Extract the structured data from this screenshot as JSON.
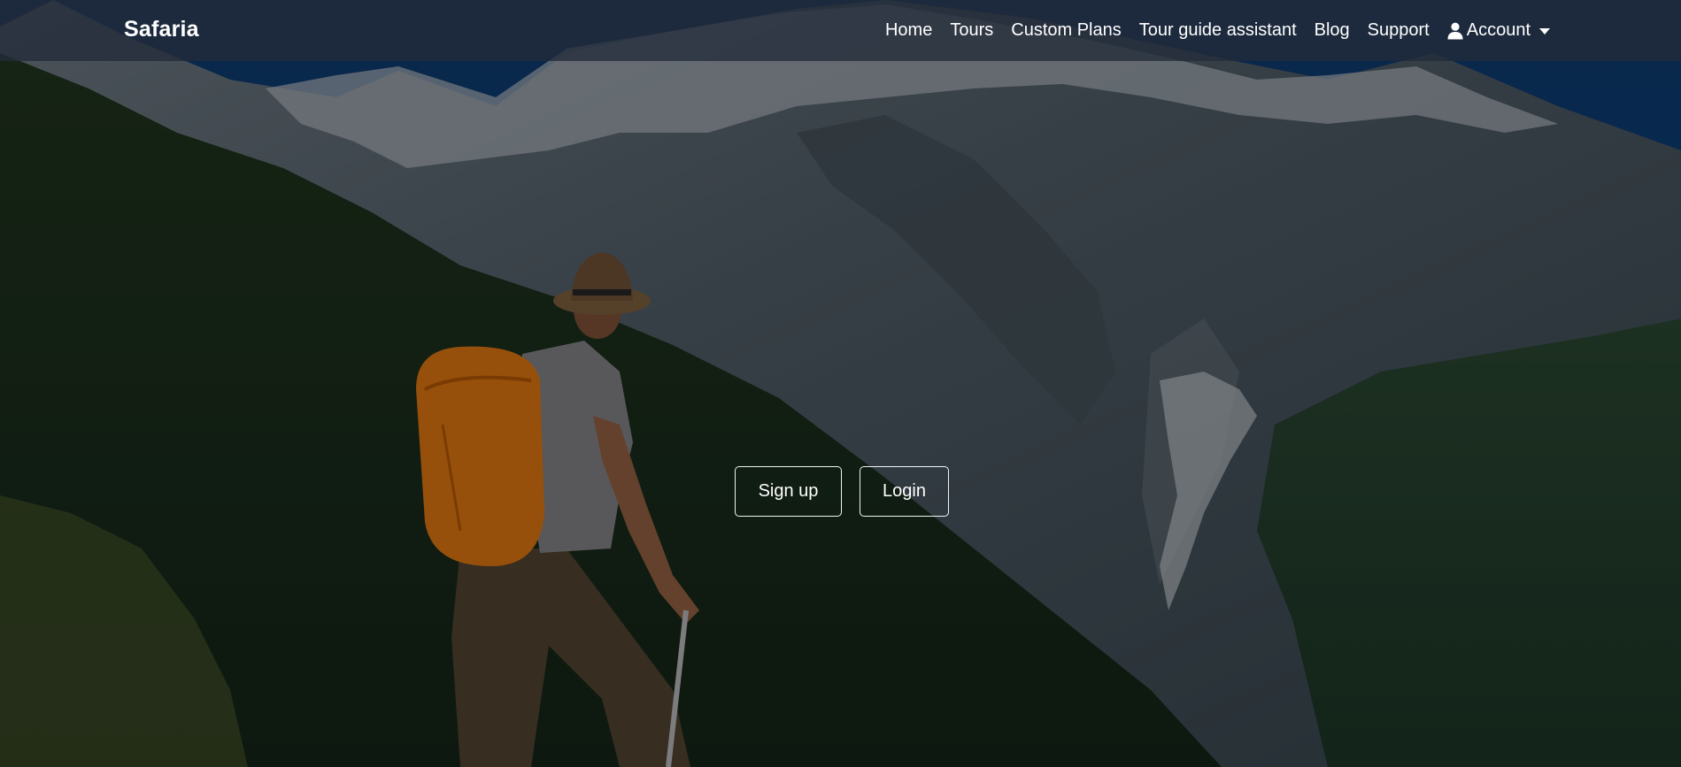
{
  "navbar": {
    "brand": "Safaria",
    "links": [
      "Home",
      "Tours",
      "Custom Plans",
      "Tour guide assistant",
      "Blog",
      "Support"
    ],
    "account": {
      "label": "Account",
      "icon": "user-icon"
    }
  },
  "hero": {
    "background": "hiker-mountain-photo",
    "signup_label": "Sign up",
    "login_label": "Login"
  },
  "colors": {
    "navbar_bg": "#222c3a",
    "sky": "#0b4a8c",
    "backpack": "#f07d10",
    "forest": "#1e3a20",
    "snow": "#c9d0d6"
  }
}
